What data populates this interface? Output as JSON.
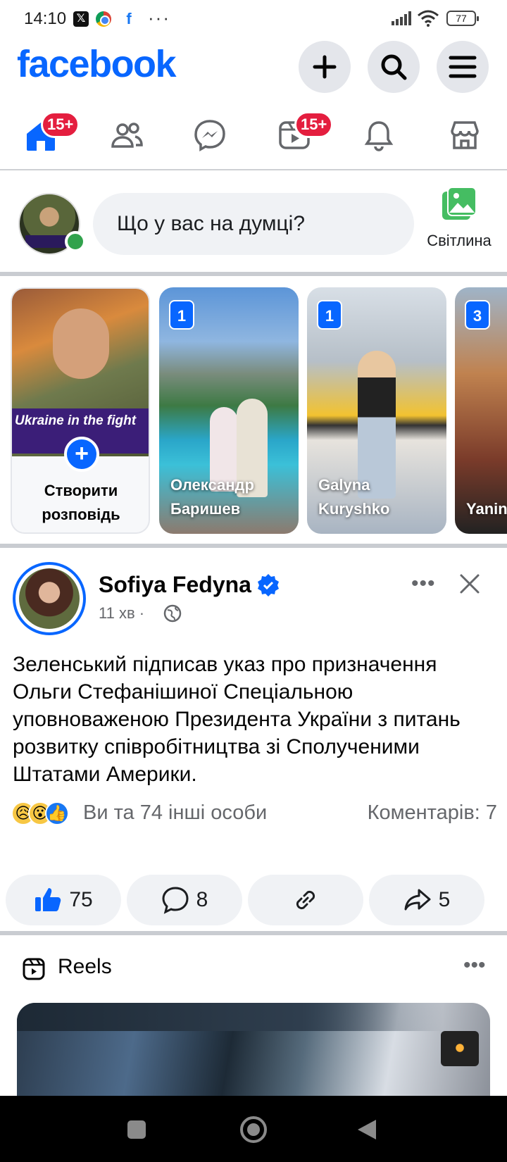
{
  "status_bar": {
    "time": "14:10",
    "icons": [
      "x-icon",
      "chrome-icon",
      "facebook-icon",
      "more-dots-icon",
      "signal-icon",
      "wifi-icon",
      "battery-icon"
    ],
    "battery": "77"
  },
  "header": {
    "logo": "facebook",
    "brand_color": "#0866ff",
    "buttons": [
      "plus-icon",
      "search-icon",
      "menu-icon"
    ]
  },
  "nav": {
    "tabs": [
      {
        "name": "home",
        "badge": "15+"
      },
      {
        "name": "friends"
      },
      {
        "name": "messenger"
      },
      {
        "name": "video",
        "badge": "15+"
      },
      {
        "name": "notifications"
      },
      {
        "name": "marketplace"
      }
    ]
  },
  "composer": {
    "placeholder": "Що у вас на думці?",
    "photo_label": "Світлина"
  },
  "stories": {
    "create_banner": "Ukraine in the fight",
    "create_label": "Створити розповідь",
    "items": [
      {
        "count": "1",
        "name": "Олександр Баришев"
      },
      {
        "count": "1",
        "name": "Galyna Kuryshko"
      },
      {
        "count": "3",
        "name": "Yanina Soko"
      }
    ]
  },
  "post": {
    "author": "Sofiya Fedyna",
    "time": "11 хв",
    "text": "Зеленський підписав указ про призначення Ольги Стефанішиної Спеціальною уповноваженою Президента України з питань розвитку співробітництва зі Сполученими Штатами Америки.",
    "reactions_text": "Ви та 74 інші особи",
    "comments_text": "Коментарів: 7",
    "likes": "75",
    "comments": "8",
    "shares": "5"
  },
  "reels": {
    "title": "Reels"
  }
}
